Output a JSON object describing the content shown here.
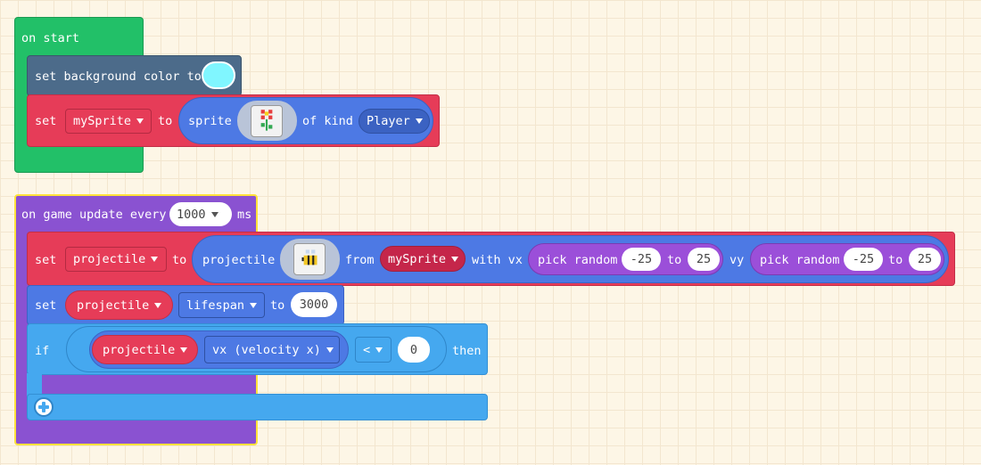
{
  "colors": {
    "event_green": "#22c068",
    "scene_slate": "#4c6b8a",
    "variable_red": "#e63c58",
    "sprite_blue": "#4d79e4",
    "game_purple": "#8a52d1",
    "math_purple": "#9b4fd9",
    "logic_lightblue": "#45a8ef",
    "highlight_yellow": "#ffe23b",
    "background_color_value": "#80f6ff"
  },
  "on_start": {
    "header": "on start",
    "bg_block": {
      "label": "set background color to",
      "color_value": "#80f6ff"
    },
    "set_block": {
      "set_label": "set",
      "variable": "mySprite",
      "to_label": "to",
      "sprite_label": "sprite",
      "sprite_image": "flower-sprite",
      "of_kind_label": "of kind",
      "kind": "Player"
    }
  },
  "on_game_update": {
    "header_prefix": "on game update every",
    "interval": "1000",
    "unit": "ms",
    "set_projectile": {
      "set_label": "set",
      "variable": "projectile",
      "to_label": "to",
      "projectile_label": "projectile",
      "projectile_image": "bee-sprite",
      "from_label": "from",
      "from_sprite": "mySprite",
      "with_vx_label": "with vx",
      "vx_random": {
        "label": "pick random",
        "min": "-25",
        "to_label": "to",
        "max": "25"
      },
      "vy_label": "vy",
      "vy_random": {
        "label": "pick random",
        "min": "-25",
        "to_label": "to",
        "max": "25"
      }
    },
    "set_lifespan": {
      "set_label": "set",
      "sprite": "projectile",
      "property": "lifespan",
      "to_label": "to",
      "value": "3000"
    },
    "if_block": {
      "if_label": "if",
      "sprite": "projectile",
      "property": "vx (velocity x)",
      "operator": "<",
      "value": "0",
      "then_label": "then"
    }
  }
}
